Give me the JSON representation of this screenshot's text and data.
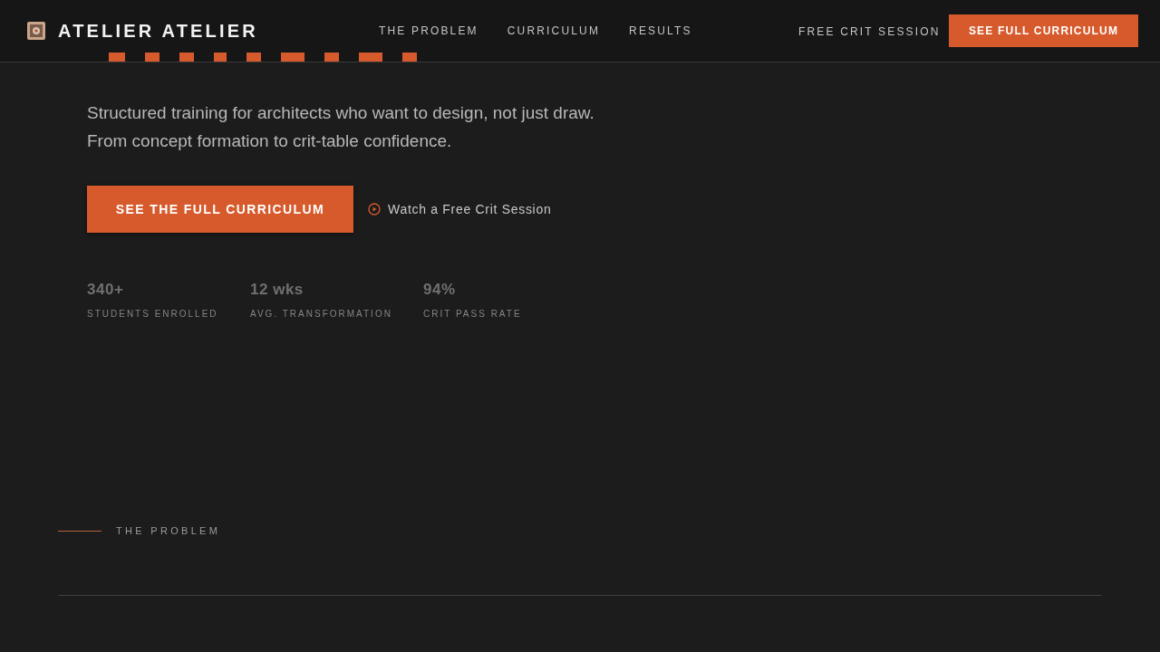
{
  "nav": {
    "brand": "ATELIER ATELIER",
    "links": [
      "THE PROBLEM",
      "CURRICULUM",
      "RESULTS"
    ],
    "secondary_link": "FREE CRIT SESSION",
    "cta": "SEE FULL CURRICULUM"
  },
  "hero": {
    "subtitle": [
      "Structured training for architects who want to design, not just draw.",
      "From concept formation to crit-table confidence."
    ],
    "primary_button": "SEE THE FULL CURRICULUM",
    "video_link": "Watch a Free Crit Session",
    "stats": [
      {
        "value": "340+",
        "label": "STUDENTS ENROLLED"
      },
      {
        "value": "12 wks",
        "label": "AVG. TRANSFORMATION"
      },
      {
        "value": "94%",
        "label": "CRIT PASS RATE"
      }
    ]
  },
  "problem_section": {
    "eyebrow": "THE PROBLEM"
  }
}
